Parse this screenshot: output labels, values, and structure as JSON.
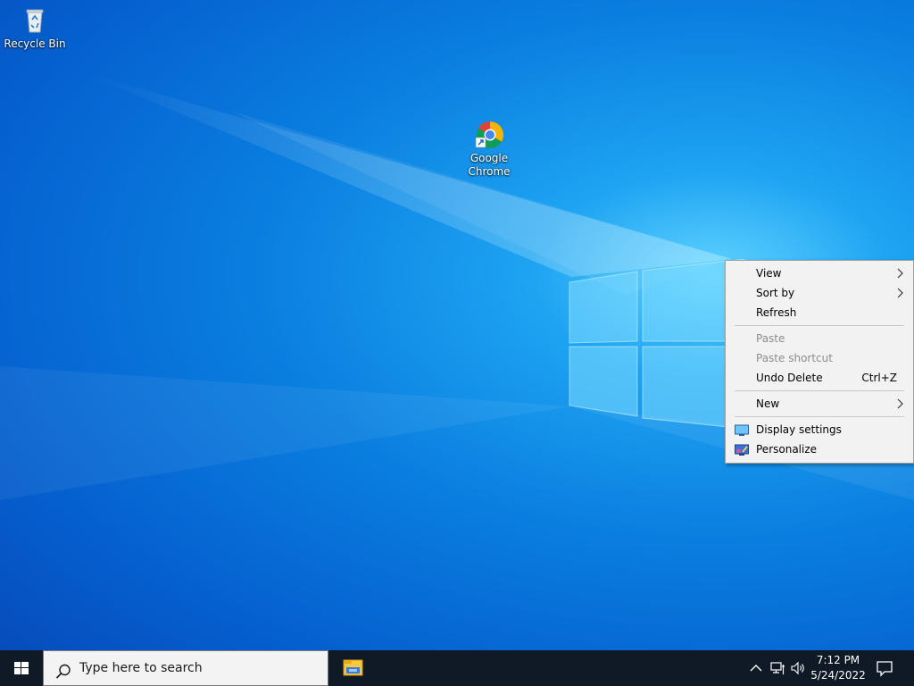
{
  "desktop": {
    "icons": [
      {
        "label": "Recycle Bin"
      },
      {
        "label": "Google Chrome"
      }
    ]
  },
  "context_menu": {
    "items": [
      {
        "label": "View"
      },
      {
        "label": "Sort by"
      },
      {
        "label": "Refresh"
      },
      {
        "label": "Paste"
      },
      {
        "label": "Paste shortcut"
      },
      {
        "label": "Undo Delete",
        "shortcut": "Ctrl+Z"
      },
      {
        "label": "New"
      },
      {
        "label": "Display settings"
      },
      {
        "label": "Personalize"
      }
    ],
    "submenu_arrow": ">"
  },
  "taskbar": {
    "search_placeholder": "Type here to search",
    "clock_time": "7:12 PM",
    "clock_date": "5/24/2022"
  },
  "icons": {
    "start": "windows-logo-icon",
    "search": "search-icon",
    "explorer": "folder-icon",
    "tray_chevron": "chevron-up-icon",
    "network": "network-icon",
    "volume": "volume-icon",
    "notifications": "notification-icon"
  },
  "colors": {
    "accent": "#0a7fe0",
    "taskbar": "#101a26",
    "menu_bg": "#f2f2f2"
  }
}
